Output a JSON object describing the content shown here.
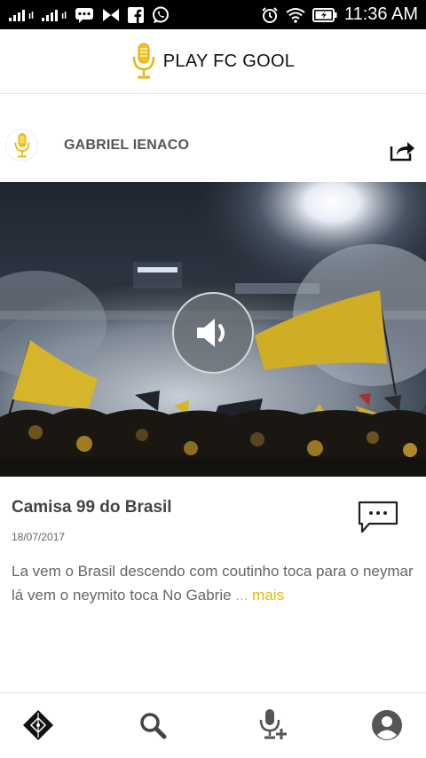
{
  "status_bar": {
    "signal_1_label": "ıl",
    "signal_2_label": "ıl",
    "time": "11:36 AM",
    "icons": [
      "signal-icon",
      "signal-icon",
      "chat-icon",
      "bowtie-icon",
      "facebook-icon",
      "whatsapp-icon",
      "alarm-icon",
      "wifi-icon",
      "battery-icon"
    ]
  },
  "header": {
    "title": "PLAY FC GOOL",
    "logo_icon": "microphone-icon"
  },
  "post": {
    "author": "GABRIEL IENACO",
    "title": "Camisa 99 do Brasil",
    "date": "18/07/2017",
    "text": "La vem o Brasil descendo com coutinho toca para o neymar lá vem o neymito toca No Gabrie ",
    "more_label": "... mais",
    "share_icon": "share-icon",
    "comment_icon": "comment-icon",
    "play_icon": "speaker-icon"
  },
  "bottom_nav": {
    "items": [
      "home-icon",
      "search-icon",
      "add-recording-icon",
      "profile-icon"
    ]
  },
  "colors": {
    "accent": "#e5b80b",
    "status_bar": "#000000",
    "text_dark": "#444444",
    "text_muted": "#666666"
  }
}
